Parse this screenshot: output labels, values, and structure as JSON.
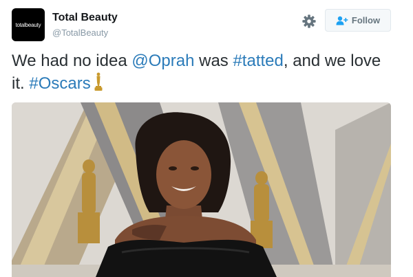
{
  "account": {
    "avatar_text": "totalbeauty",
    "name": "Total Beauty",
    "handle": "@TotalBeauty"
  },
  "actions": {
    "follow_label": "Follow"
  },
  "tweet": {
    "text_1": "We had no idea ",
    "mention": "@Oprah",
    "text_2": " was ",
    "hashtag_1": "#tatted",
    "text_3": ", and we love it. ",
    "hashtag_2": "#Oscars"
  },
  "icons": {
    "settings": "gear-icon",
    "follow": "add-user-icon",
    "emoji": "oscar-trophy-icon"
  },
  "colors": {
    "link": "#2b7bb9",
    "text": "#292f33",
    "muted": "#8899a6",
    "button_text": "#66757f"
  }
}
